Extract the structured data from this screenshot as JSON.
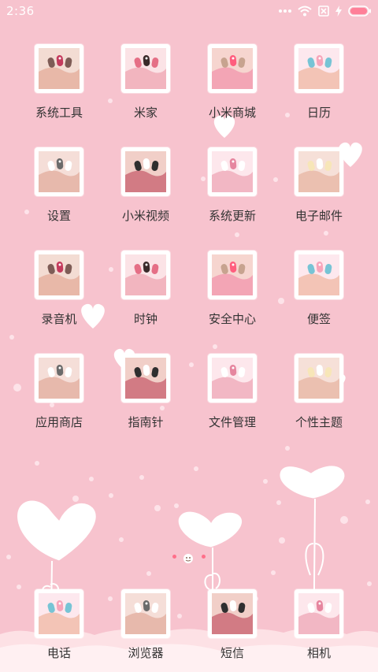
{
  "status_bar": {
    "time": "2:36"
  },
  "grid": [
    {
      "label": "系统工具",
      "id": "system-tools",
      "icon": "folder-icon"
    },
    {
      "label": "米家",
      "id": "mijia",
      "icon": "mijia-icon"
    },
    {
      "label": "小米商城",
      "id": "mi-store",
      "icon": "store-icon"
    },
    {
      "label": "日历",
      "id": "calendar",
      "icon": "calendar-icon"
    },
    {
      "label": "设置",
      "id": "settings",
      "icon": "gear-icon"
    },
    {
      "label": "小米视频",
      "id": "mi-video",
      "icon": "video-icon"
    },
    {
      "label": "系统更新",
      "id": "system-update",
      "icon": "update-icon"
    },
    {
      "label": "电子邮件",
      "id": "email",
      "icon": "mail-icon"
    },
    {
      "label": "录音机",
      "id": "recorder",
      "icon": "microphone-icon"
    },
    {
      "label": "时钟",
      "id": "clock",
      "icon": "clock-icon"
    },
    {
      "label": "安全中心",
      "id": "security-center",
      "icon": "shield-icon"
    },
    {
      "label": "便签",
      "id": "notes",
      "icon": "note-icon"
    },
    {
      "label": "应用商店",
      "id": "app-store",
      "icon": "shop-bag-icon"
    },
    {
      "label": "指南针",
      "id": "compass",
      "icon": "compass-icon"
    },
    {
      "label": "文件管理",
      "id": "file-manager",
      "icon": "folder-icon"
    },
    {
      "label": "个性主题",
      "id": "themes",
      "icon": "palette-icon"
    }
  ],
  "dock": [
    {
      "label": "电话",
      "id": "phone",
      "icon": "phone-icon"
    },
    {
      "label": "浏览器",
      "id": "browser",
      "icon": "globe-icon"
    },
    {
      "label": "短信",
      "id": "messages",
      "icon": "message-icon"
    },
    {
      "label": "相机",
      "id": "camera",
      "icon": "camera-icon"
    }
  ],
  "colors": {
    "background": "#f7c3ce",
    "accent": "#ff6f8a"
  }
}
